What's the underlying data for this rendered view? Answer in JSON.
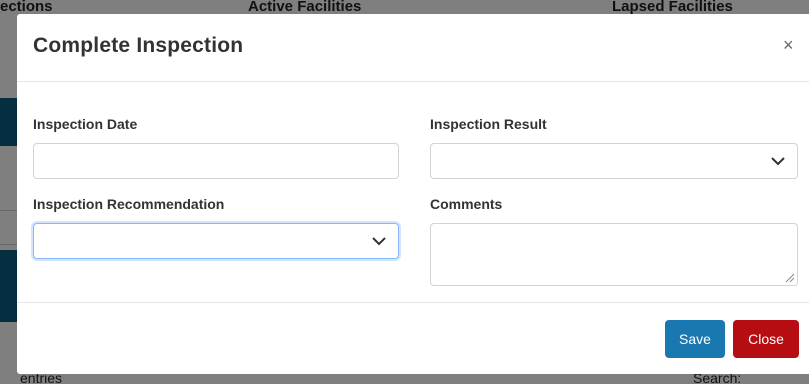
{
  "background": {
    "header_cols": [
      "ections",
      "Active Facilities",
      "Lapsed Facilities"
    ],
    "footer_left": "entries",
    "footer_right": "Search:"
  },
  "modal": {
    "title": "Complete Inspection",
    "close_symbol": "×",
    "fields": {
      "inspection_date": {
        "label": "Inspection Date",
        "value": ""
      },
      "inspection_result": {
        "label": "Inspection Result",
        "value": ""
      },
      "inspection_recommendation": {
        "label": "Inspection Recommendation",
        "value": ""
      },
      "comments": {
        "label": "Comments",
        "value": ""
      }
    },
    "buttons": {
      "save": "Save",
      "close": "Close"
    }
  },
  "colors": {
    "save": "#1a78b0",
    "close": "#b50d12",
    "backdrop_accent": "#0b5e83"
  }
}
